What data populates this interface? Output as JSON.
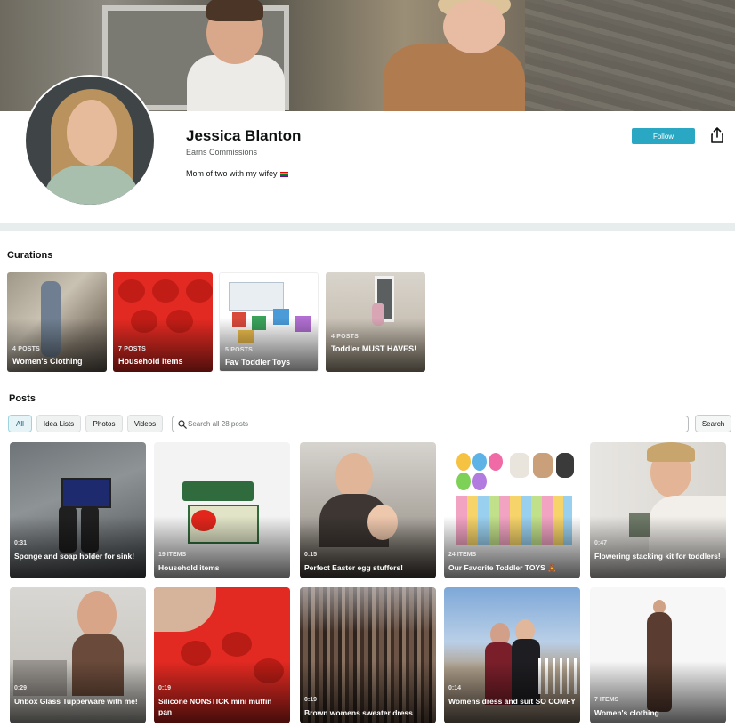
{
  "profile": {
    "name": "Jessica Blanton",
    "subtitle": "Earns Commissions",
    "bio": "Mom of two with my wifey",
    "follow_label": "Follow"
  },
  "curations": {
    "title": "Curations",
    "items": [
      {
        "count": "4 POSTS",
        "label": "Women's Clothing"
      },
      {
        "count": "7 POSTS",
        "label": "Household items"
      },
      {
        "count": "5 POSTS",
        "label": "Fav Toddler Toys"
      },
      {
        "count": "4 POSTS",
        "label": "Toddler MUST HAVES!"
      }
    ]
  },
  "posts": {
    "title": "Posts",
    "filters": [
      "All",
      "Idea Lists",
      "Photos",
      "Videos"
    ],
    "active_filter": "All",
    "search_placeholder": "Search all 28 posts",
    "search_button": "Search",
    "items": [
      {
        "meta": "0:31",
        "label": "Sponge and soap holder for sink!"
      },
      {
        "meta": "19 ITEMS",
        "label": "Household items"
      },
      {
        "meta": "0:15",
        "label": "Perfect Easter egg stuffers!"
      },
      {
        "meta": "24 ITEMS",
        "label": "Our Favorite Toddler TOYS 🧸"
      },
      {
        "meta": "0:47",
        "label": "Flowering stacking kit for toddlers!"
      },
      {
        "meta": "0:29",
        "label": "Unbox Glass Tupperware with me!"
      },
      {
        "meta": "0:19",
        "label": "Silicone NONSTICK mini muffin pan"
      },
      {
        "meta": "0:19",
        "label": "Brown womens sweater dress"
      },
      {
        "meta": "0:14",
        "label": "Womens dress and suit SO COMFY"
      },
      {
        "meta": "7 ITEMS",
        "label": "Women's clothing"
      }
    ]
  },
  "colors": {
    "accent": "#2aa8c3",
    "divider": "#e7ecec",
    "muffin_red": "#e32a22"
  }
}
